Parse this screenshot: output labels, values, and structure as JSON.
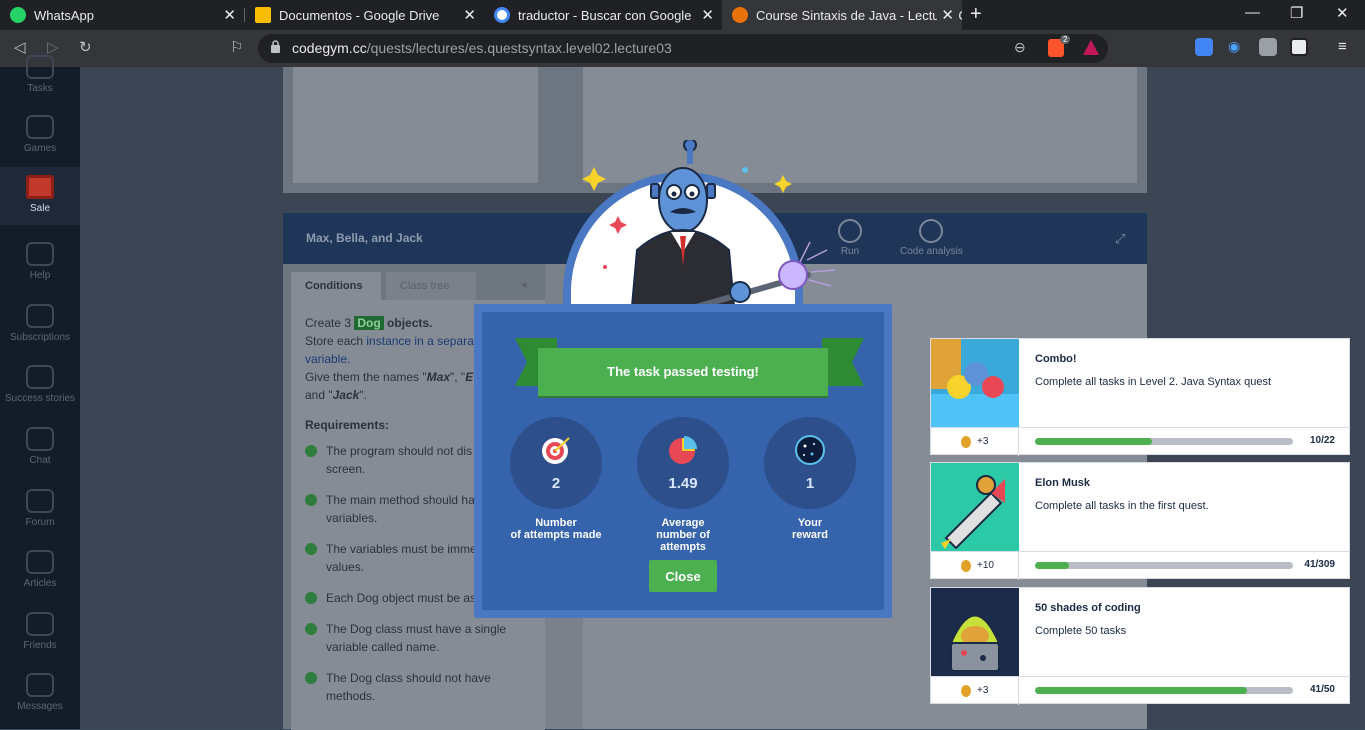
{
  "browser": {
    "tabs": [
      {
        "title": "WhatsApp",
        "color": "#25d366"
      },
      {
        "title": "Documentos - Google Drive",
        "color": "#fbbc04"
      },
      {
        "title": "traductor - Buscar con Google",
        "color": "#4285f4"
      },
      {
        "title": "Course Sintaxis de Java - Lecture: C",
        "color": "#e8710a"
      }
    ],
    "url_host": "codegym.cc",
    "url_path": "/quests/lectures/es.questsyntax.level02.lecture03",
    "brave_badge": "2"
  },
  "sidebar": {
    "items": [
      {
        "label": "Tasks"
      },
      {
        "label": "Games"
      },
      {
        "label": "Sale"
      },
      {
        "label": "Help"
      },
      {
        "label": "Subscriptions"
      },
      {
        "label": "Success stories"
      },
      {
        "label": "Chat"
      },
      {
        "label": "Forum"
      },
      {
        "label": "Articles"
      },
      {
        "label": "Friends"
      },
      {
        "label": "Messages"
      }
    ]
  },
  "task": {
    "title": "Max, Bella, and Jack",
    "run_label": "Run",
    "analysis_label": "Code analysis",
    "tab_conditions": "Conditions",
    "tab_class_tree": "Class tree",
    "cond_create": "Create 3",
    "cond_tag": "Dog",
    "cond_objects": "objects.",
    "cond_store": "Store each",
    "cond_link": "instance in a separa",
    "cond_link2": "variable.",
    "cond_names1": "Give them the names \"",
    "cond_max": "Max",
    "cond_names2": "\", \"",
    "cond_e": "E",
    "cond_and": "and \"",
    "cond_jack": "Jack",
    "cond_end": "\".",
    "requirements_heading": "Requirements:",
    "requirements": [
      "The program should not dis on the screen.",
      "The main method should ha three Dog variables.",
      "The variables must be imme assigned values.",
      "Each Dog object must be as name.",
      "The Dog class must have a single variable called name.",
      "The Dog class should not have methods."
    ]
  },
  "modal": {
    "banner": "The task passed testing!",
    "stats": [
      {
        "value": "2",
        "label1": "Number",
        "label2": "of attempts made"
      },
      {
        "value": "1.49",
        "label1": "Average",
        "label2": "number of attempts"
      },
      {
        "value": "1",
        "label1": "Your",
        "label2": "reward"
      }
    ],
    "close_label": "Close"
  },
  "achievements": [
    {
      "title": "Combo!",
      "desc": "Complete all tasks in Level 2. Java Syntax quest",
      "reward": "+3",
      "progress": "10/22",
      "fraction": 0.4545,
      "bg": "#3aa8d8"
    },
    {
      "title": "Elon Musk",
      "desc": "Complete all tasks in the first quest.",
      "reward": "+10",
      "progress": "41/309",
      "fraction": 0.1327,
      "bg": "#2bc9a6"
    },
    {
      "title": "50 shades of coding",
      "desc": "Complete 50 tasks",
      "reward": "+3",
      "progress": "41/50",
      "fraction": 0.82,
      "bg": "#1d2b4a"
    }
  ]
}
